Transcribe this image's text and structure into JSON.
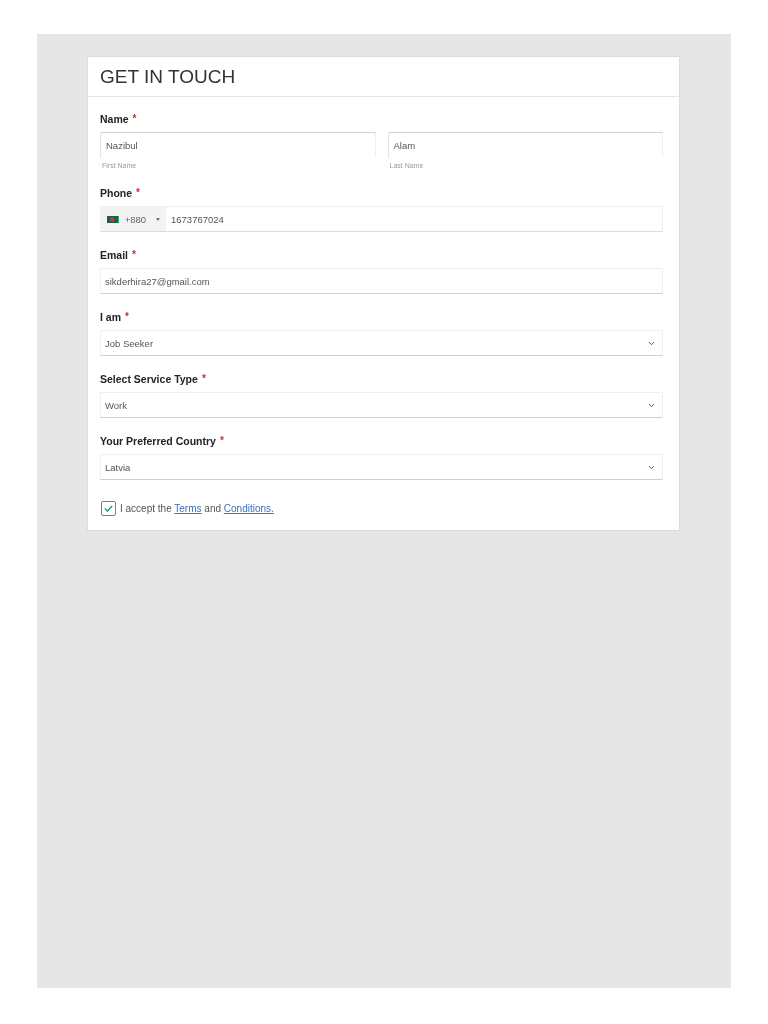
{
  "form": {
    "title": "GET IN TOUCH",
    "fields": [
      {
        "kind": "split",
        "label": "Name",
        "required_mark": "*",
        "parts": [
          {
            "value": "Nazibul",
            "sublabel": "First Name"
          },
          {
            "value": "Alam",
            "sublabel": "Last Name"
          }
        ]
      },
      {
        "kind": "phone",
        "label": "Phone",
        "required_mark": "*",
        "dial_code": "+880",
        "value": "1673767024"
      },
      {
        "kind": "text",
        "label": "Email",
        "required_mark": "*",
        "value": "sikderhira27@gmail.com"
      },
      {
        "kind": "select",
        "label": "I am",
        "required_mark": "*",
        "value": "Job Seeker"
      },
      {
        "kind": "select",
        "label": "Select Service Type",
        "required_mark": "*",
        "value": "Work"
      },
      {
        "kind": "select",
        "label": "Your Preferred Country",
        "required_mark": "*",
        "value": "Latvia"
      }
    ],
    "consent": {
      "checked": true,
      "parts": [
        {
          "kind": "text",
          "text": "I accept the"
        },
        {
          "kind": "link",
          "text": "Terms"
        },
        {
          "kind": "text",
          "text": "and"
        },
        {
          "kind": "link",
          "text": "Conditions."
        }
      ]
    }
  }
}
